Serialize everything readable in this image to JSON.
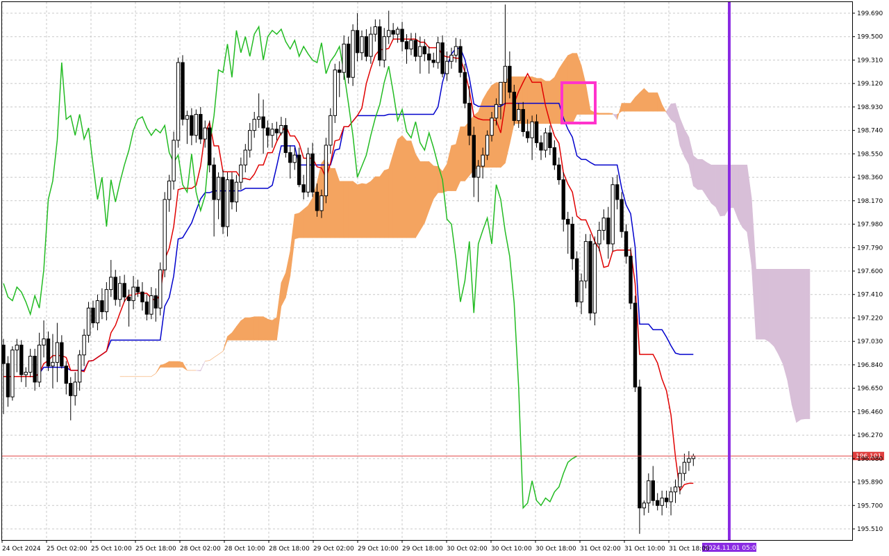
{
  "chart_data": {
    "type": "candlestick",
    "title": "",
    "y_ticks": [
      199.69,
      199.5,
      199.31,
      199.12,
      198.93,
      198.74,
      198.55,
      198.36,
      198.17,
      197.98,
      197.79,
      197.6,
      197.41,
      197.22,
      197.03,
      196.84,
      196.65,
      196.46,
      196.27,
      196.08,
      195.89,
      195.7,
      195.51
    ],
    "y_tick_labels": [
      "199.690",
      "199.500",
      "199.310",
      "199.120",
      "198.930",
      "198.740",
      "198.550",
      "198.360",
      "198.170",
      "197.980",
      "197.790",
      "197.600",
      "197.410",
      "197.220",
      "197.030",
      "196.840",
      "196.650",
      "196.460",
      "196.270",
      "196.080",
      "195.890",
      "195.700",
      "195.510"
    ],
    "ylim": [
      195.42,
      199.78
    ],
    "x_tick_labels": [
      "24 Oct 2024",
      "25 Oct 02:00",
      "25 Oct 10:00",
      "25 Oct 18:00",
      "28 Oct 02:00",
      "28 Oct 10:00",
      "28 Oct 18:00",
      "29 Oct 02:00",
      "29 Oct 10:00",
      "29 Oct 18:00",
      "30 Oct 02:00",
      "30 Oct 10:00",
      "30 Oct 18:00",
      "31 Oct 02:00",
      "31 Oct 10:00",
      "31 Oct 18:00"
    ],
    "current_price": 196.101,
    "current_price_label": "196.101",
    "vertical_marker_label": "2024.11.01 05:00",
    "bars": [
      [
        197.0,
        197.05,
        196.44,
        196.85
      ],
      [
        196.85,
        196.91,
        196.5,
        196.58
      ],
      [
        196.58,
        196.99,
        196.55,
        196.96
      ],
      [
        196.96,
        197.05,
        196.78,
        197.0
      ],
      [
        197.0,
        197.04,
        196.7,
        196.76
      ],
      [
        196.76,
        196.82,
        196.66,
        196.78
      ],
      [
        196.78,
        196.97,
        196.74,
        196.91
      ],
      [
        196.91,
        196.97,
        196.63,
        196.7
      ],
      [
        196.7,
        197.1,
        196.66,
        197.0
      ],
      [
        197.0,
        197.2,
        196.9,
        197.05
      ],
      [
        197.05,
        197.11,
        196.79,
        196.83
      ],
      [
        196.83,
        197.09,
        196.65,
        196.86
      ],
      [
        196.86,
        197.18,
        196.7,
        197.02
      ],
      [
        197.02,
        197.08,
        196.81,
        196.83
      ],
      [
        196.83,
        196.87,
        196.6,
        196.69
      ],
      [
        196.69,
        196.74,
        196.39,
        196.59
      ],
      [
        196.59,
        196.78,
        196.51,
        196.7
      ],
      [
        196.7,
        196.96,
        196.63,
        196.92
      ],
      [
        196.92,
        197.13,
        196.83,
        197.08
      ],
      [
        197.08,
        197.35,
        197.02,
        197.3
      ],
      [
        197.3,
        197.36,
        197.14,
        197.18
      ],
      [
        197.18,
        197.41,
        197.12,
        197.36
      ],
      [
        197.36,
        197.46,
        197.21,
        197.27
      ],
      [
        197.27,
        197.51,
        197.2,
        197.45
      ],
      [
        197.45,
        197.69,
        197.39,
        197.55
      ],
      [
        197.55,
        197.61,
        197.32,
        197.37
      ],
      [
        197.37,
        197.56,
        197.31,
        197.5
      ],
      [
        197.5,
        197.57,
        197.35,
        197.39
      ],
      [
        197.39,
        197.45,
        197.15,
        197.36
      ],
      [
        197.36,
        197.56,
        197.29,
        197.47
      ],
      [
        197.47,
        197.53,
        197.39,
        197.43
      ],
      [
        197.43,
        197.51,
        197.28,
        197.35
      ],
      [
        197.35,
        197.41,
        197.2,
        197.25
      ],
      [
        197.25,
        197.47,
        197.21,
        197.4
      ],
      [
        197.4,
        197.46,
        197.19,
        197.3
      ],
      [
        197.3,
        197.67,
        197.24,
        197.61
      ],
      [
        197.61,
        198.24,
        197.55,
        198.18
      ],
      [
        198.18,
        198.38,
        198.08,
        198.33
      ],
      [
        198.33,
        198.73,
        198.26,
        198.66
      ],
      [
        198.66,
        199.33,
        198.6,
        199.29
      ],
      [
        199.29,
        199.35,
        198.78,
        198.83
      ],
      [
        198.83,
        198.9,
        198.63,
        198.86
      ],
      [
        198.86,
        198.92,
        198.62,
        198.7
      ],
      [
        198.7,
        198.91,
        198.64,
        198.87
      ],
      [
        198.87,
        198.93,
        198.63,
        198.67
      ],
      [
        198.67,
        198.82,
        198.6,
        198.76
      ],
      [
        198.76,
        198.82,
        198.4,
        198.46
      ],
      [
        198.46,
        198.52,
        197.88,
        198.18
      ],
      [
        198.18,
        198.4,
        198.02,
        198.36
      ],
      [
        198.36,
        198.42,
        197.9,
        197.96
      ],
      [
        197.96,
        198.4,
        197.88,
        198.34
      ],
      [
        198.34,
        198.4,
        198.1,
        198.16
      ],
      [
        198.16,
        198.38,
        198.08,
        198.32
      ],
      [
        198.32,
        198.52,
        198.26,
        198.46
      ],
      [
        198.46,
        198.63,
        198.4,
        198.58
      ],
      [
        198.58,
        198.8,
        198.52,
        198.74
      ],
      [
        198.74,
        198.89,
        198.68,
        198.83
      ],
      [
        198.83,
        199.04,
        198.76,
        198.85
      ],
      [
        198.85,
        198.99,
        198.55,
        198.76
      ],
      [
        198.76,
        198.82,
        198.6,
        198.7
      ],
      [
        198.7,
        198.8,
        198.6,
        198.75
      ],
      [
        198.75,
        198.81,
        198.66,
        198.72
      ],
      [
        198.72,
        198.85,
        198.7,
        198.78
      ],
      [
        198.78,
        198.84,
        198.52,
        198.56
      ],
      [
        198.56,
        198.62,
        198.35,
        198.48
      ],
      [
        198.48,
        198.6,
        198.42,
        198.54
      ],
      [
        198.54,
        198.6,
        198.28,
        198.3
      ],
      [
        198.3,
        198.38,
        198.18,
        198.24
      ],
      [
        198.24,
        198.6,
        198.2,
        198.55
      ],
      [
        198.55,
        198.64,
        198.2,
        198.24
      ],
      [
        198.24,
        198.31,
        198.04,
        198.09
      ],
      [
        198.09,
        198.26,
        198.03,
        198.21
      ],
      [
        198.21,
        198.68,
        198.15,
        198.62
      ],
      [
        198.62,
        198.92,
        198.55,
        198.86
      ],
      [
        198.86,
        199.28,
        198.8,
        199.23
      ],
      [
        199.23,
        199.3,
        199.01,
        199.21
      ],
      [
        199.21,
        199.51,
        199.15,
        199.44
      ],
      [
        199.44,
        199.5,
        199.12,
        199.17
      ],
      [
        199.17,
        199.6,
        199.1,
        199.55
      ],
      [
        199.55,
        199.69,
        199.3,
        199.37
      ],
      [
        199.37,
        199.55,
        199.31,
        199.5
      ],
      [
        199.5,
        199.56,
        199.3,
        199.34
      ],
      [
        199.34,
        199.58,
        199.28,
        199.52
      ],
      [
        199.52,
        199.64,
        199.46,
        199.58
      ],
      [
        199.58,
        199.64,
        199.26,
        199.31
      ],
      [
        199.31,
        199.57,
        199.25,
        199.5
      ],
      [
        199.5,
        199.71,
        199.44,
        199.55
      ],
      [
        199.55,
        199.61,
        199.48,
        199.52
      ],
      [
        199.52,
        199.58,
        199.45,
        199.56
      ],
      [
        199.56,
        199.62,
        199.38,
        199.46
      ],
      [
        199.46,
        199.52,
        199.28,
        199.4
      ],
      [
        199.4,
        199.53,
        199.35,
        199.47
      ],
      [
        199.47,
        199.53,
        199.3,
        199.34
      ],
      [
        199.34,
        199.5,
        199.2,
        199.42
      ],
      [
        199.42,
        199.48,
        199.3,
        199.36
      ],
      [
        199.36,
        199.42,
        199.2,
        199.31
      ],
      [
        199.31,
        199.37,
        199.25,
        199.29
      ],
      [
        199.29,
        199.5,
        199.24,
        199.45
      ],
      [
        199.45,
        199.51,
        199.17,
        199.2
      ],
      [
        199.2,
        199.38,
        199.14,
        199.3
      ],
      [
        199.3,
        199.41,
        199.24,
        199.35
      ],
      [
        199.35,
        199.49,
        199.29,
        199.42
      ],
      [
        199.42,
        199.48,
        199.17,
        199.21
      ],
      [
        199.21,
        199.28,
        198.92,
        198.96
      ],
      [
        198.96,
        199.1,
        198.62,
        198.7
      ],
      [
        198.7,
        198.77,
        198.2,
        198.36
      ],
      [
        198.36,
        198.5,
        198.16,
        198.45
      ],
      [
        198.45,
        198.6,
        198.35,
        198.54
      ],
      [
        198.54,
        198.74,
        198.5,
        198.7
      ],
      [
        198.7,
        198.89,
        198.65,
        198.84
      ],
      [
        198.84,
        199.0,
        198.78,
        198.95
      ],
      [
        198.95,
        199.06,
        198.83,
        199.13
      ],
      [
        199.13,
        199.76,
        198.95,
        199.26
      ],
      [
        199.26,
        199.38,
        199.0,
        199.05
      ],
      [
        199.05,
        199.11,
        198.78,
        198.82
      ],
      [
        198.82,
        198.96,
        198.76,
        198.91
      ],
      [
        198.91,
        198.97,
        198.69,
        198.73
      ],
      [
        198.73,
        198.83,
        198.64,
        198.68
      ],
      [
        198.68,
        198.86,
        198.5,
        198.81
      ],
      [
        198.81,
        198.87,
        198.6,
        198.64
      ],
      [
        198.64,
        198.7,
        198.5,
        198.58
      ],
      [
        198.58,
        198.76,
        198.52,
        198.72
      ],
      [
        198.72,
        198.78,
        198.54,
        198.6
      ],
      [
        198.6,
        198.66,
        198.42,
        198.46
      ],
      [
        198.46,
        198.52,
        198.3,
        198.34
      ],
      [
        198.34,
        198.4,
        197.92,
        198.02
      ],
      [
        198.02,
        198.08,
        197.74,
        197.98
      ],
      [
        197.98,
        198.04,
        197.61,
        197.7
      ],
      [
        197.7,
        197.76,
        197.31,
        197.35
      ],
      [
        197.35,
        197.58,
        197.25,
        197.52
      ],
      [
        197.52,
        197.9,
        197.46,
        197.84
      ],
      [
        197.84,
        197.9,
        197.2,
        197.26
      ],
      [
        197.26,
        197.88,
        197.16,
        197.82
      ],
      [
        197.82,
        198.0,
        197.76,
        197.93
      ],
      [
        197.93,
        198.1,
        197.85,
        198.03
      ],
      [
        198.03,
        198.12,
        197.7,
        197.82
      ],
      [
        197.82,
        198.36,
        197.76,
        198.3
      ],
      [
        198.3,
        198.38,
        198.1,
        198.18
      ],
      [
        198.18,
        198.24,
        197.87,
        197.92
      ],
      [
        197.92,
        197.98,
        197.66,
        197.72
      ],
      [
        197.72,
        197.79,
        197.29,
        197.34
      ],
      [
        197.34,
        197.4,
        196.62,
        196.66
      ],
      [
        196.66,
        196.72,
        195.47,
        195.68
      ],
      [
        195.68,
        195.74,
        195.62,
        195.72
      ],
      [
        195.72,
        195.96,
        195.64,
        195.9
      ],
      [
        195.9,
        196.02,
        195.7,
        195.74
      ],
      [
        195.74,
        195.8,
        195.66,
        195.7
      ],
      [
        195.7,
        195.82,
        195.62,
        195.76
      ],
      [
        195.76,
        195.82,
        195.68,
        195.73
      ],
      [
        195.73,
        195.85,
        195.62,
        195.81
      ],
      [
        195.81,
        195.91,
        195.72,
        195.85
      ],
      [
        195.85,
        196.02,
        195.79,
        195.96
      ],
      [
        195.96,
        196.12,
        195.9,
        196.05
      ],
      [
        196.05,
        196.14,
        195.98,
        196.08
      ],
      [
        196.08,
        196.12,
        196.02,
        196.1
      ]
    ],
    "series": [
      {
        "name": "",
        "color": "#e00000",
        "role": "tenkan"
      },
      {
        "name": "",
        "color": "#0000cc",
        "role": "kijun"
      },
      {
        "name": "",
        "color": "#22bb22",
        "role": "chikou"
      }
    ],
    "kumo_bull_color": "#f4a460",
    "kumo_bear_color": "#d8bfd8",
    "current_price_color": "#e04040",
    "vertical_marker_color": "#8a2be2",
    "highlight_box_color": "#ff33cc",
    "grid": true
  }
}
